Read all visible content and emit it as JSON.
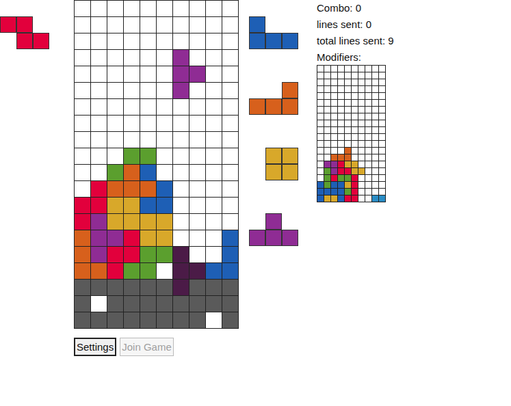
{
  "palette": {
    "Z": "#e2003c",
    "L": "#d7601c",
    "O": "#d8a82a",
    "S": "#5b9f2e",
    "J": "#1e5fb5",
    "T": "#8f2c94",
    "G": "#4b1b47",
    "X": "#5a5a5a",
    "C": "#2a8cc4"
  },
  "hold": {
    "shape": [
      "ZZ.",
      ".ZZ"
    ]
  },
  "next": [
    {
      "shape": [
        "J..",
        "JJJ"
      ]
    },
    {
      "shape": [
        "..L",
        "LLL"
      ]
    },
    {
      "shape": [
        ".OO",
        ".OO"
      ]
    },
    {
      "shape": [
        ".T.",
        "TTT"
      ]
    }
  ],
  "board": {
    "rows": [
      "..........",
      "..........",
      "..........",
      "......T...",
      "......TT..",
      "......T...",
      "..........",
      "..........",
      "..........",
      "...SS.....",
      "..SLJ.....",
      ".ZLLLJ....",
      "ZZOOJJ....",
      "ZTOOOO....",
      "LTTZOO...J",
      "LTZZSSG..J",
      "LLZSS.GGJJ",
      "XXXXXXGXXX",
      "X.XXXXXXXX",
      "XXXXXXXX.X"
    ]
  },
  "stats": [
    "Combo: 0",
    "lines sent: 0",
    "total lines sent: 9",
    "Modifiers:"
  ],
  "opponent_board": {
    "rows": [
      "..........",
      "..........",
      "..........",
      "..........",
      "..........",
      "..........",
      "..........",
      "..........",
      "..........",
      "..........",
      "..........",
      "..........",
      "....L.....",
      "..LLL.....",
      ".TTZOO....",
      ".STZZOO...",
      ".SZSSZ....",
      "JSJJOZ....",
      "JJJJSZ....",
      "JOOJZZ..CC"
    ]
  },
  "buttons": [
    {
      "label": "Settings",
      "disabled": false
    },
    {
      "label": "Join Game",
      "disabled": true
    }
  ]
}
